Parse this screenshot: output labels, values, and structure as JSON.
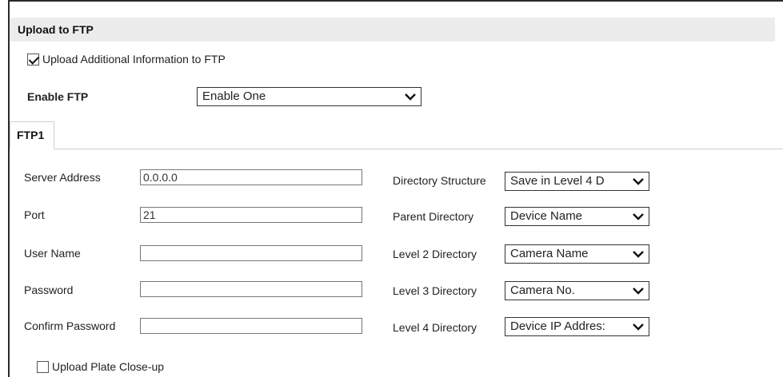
{
  "section": {
    "title": "Upload to FTP"
  },
  "upload_info": {
    "label": "Upload Additional Information to FTP",
    "checked": true
  },
  "enable_ftp": {
    "label": "Enable FTP",
    "value": "Enable One"
  },
  "tabs": [
    {
      "label": "FTP1",
      "active": true
    }
  ],
  "left_fields": {
    "server_address": {
      "label": "Server Address",
      "value": "0.0.0.0"
    },
    "port": {
      "label": "Port",
      "value": "21"
    },
    "user_name": {
      "label": "User Name",
      "value": ""
    },
    "password": {
      "label": "Password",
      "value": ""
    },
    "confirm_password": {
      "label": "Confirm Password",
      "value": ""
    }
  },
  "right_fields": {
    "directory_structure": {
      "label": "Directory Structure",
      "value": "Save in Level 4 D"
    },
    "parent_directory": {
      "label": "Parent Directory",
      "value": "Device Name"
    },
    "level2_directory": {
      "label": "Level 2 Directory",
      "value": "Camera Name"
    },
    "level3_directory": {
      "label": "Level 3 Directory",
      "value": "Camera No."
    },
    "level4_directory": {
      "label": "Level 4 Directory",
      "value": "Device IP Addres:"
    }
  },
  "upload_plate": {
    "label": "Upload Plate Close-up",
    "checked": false
  },
  "icons": {
    "dropdown": "chevron-down-icon",
    "checkbox_mark": "check-icon"
  }
}
